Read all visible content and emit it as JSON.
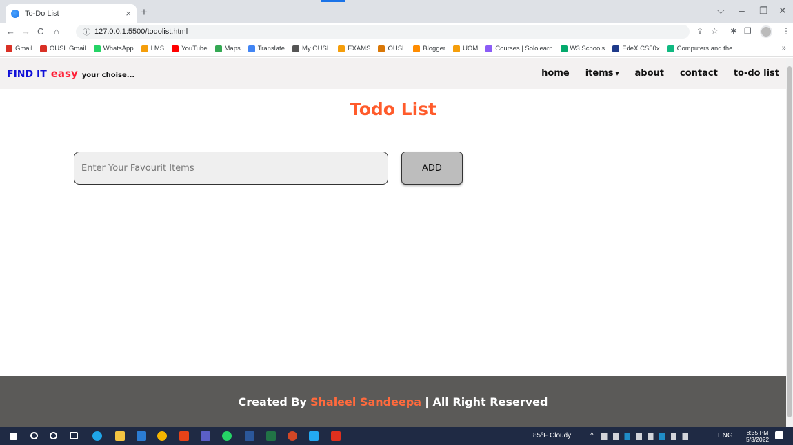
{
  "browser": {
    "tab_title": "To-Do List",
    "tab_close": "×",
    "new_tab": "+",
    "url": "127.0.0.1:5500/todolist.html",
    "nav": {
      "back": "←",
      "forward": "→",
      "reload": "C",
      "home": "⌂",
      "info": "ⓘ"
    },
    "window": {
      "dropdown": "⌵",
      "minimize": "–",
      "restore": "❐",
      "close": "✕"
    },
    "toolbar": {
      "share": "⇪",
      "star": "☆",
      "extensions": "✱",
      "sidebar": "❒",
      "menu": "⋮"
    },
    "bookmarks": [
      {
        "label": "Gmail",
        "color": "#d93025"
      },
      {
        "label": "OUSL Gmail",
        "color": "#d93025"
      },
      {
        "label": "WhatsApp",
        "color": "#25d366"
      },
      {
        "label": "LMS",
        "color": "#f59e0b"
      },
      {
        "label": "YouTube",
        "color": "#ff0000"
      },
      {
        "label": "Maps",
        "color": "#34a853"
      },
      {
        "label": "Translate",
        "color": "#4285f4"
      },
      {
        "label": "My OUSL",
        "color": "#555555"
      },
      {
        "label": "EXAMS",
        "color": "#f59e0b"
      },
      {
        "label": "OUSL",
        "color": "#d97706"
      },
      {
        "label": "Blogger",
        "color": "#ff8c00"
      },
      {
        "label": "UOM",
        "color": "#f59e0b"
      },
      {
        "label": "Courses | Sololearn",
        "color": "#8b5cf6"
      },
      {
        "label": "W3 Schools",
        "color": "#04aa6d"
      },
      {
        "label": "EdeX CS50x",
        "color": "#1e3a8a"
      },
      {
        "label": "Computers and the...",
        "color": "#10b981"
      }
    ],
    "bookmarks_more": "»"
  },
  "navbar": {
    "brand_find": "FIND IT",
    "brand_easy": "easy",
    "brand_tagline": "your choise...",
    "links": {
      "home": "home",
      "items": "items",
      "items_caret": "▾",
      "about": "about",
      "contact": "contact",
      "todo": "to-do list"
    }
  },
  "main": {
    "title": "Todo List",
    "input_placeholder": "Enter Your Favourit Items",
    "input_value": "",
    "add_label": "ADD"
  },
  "footer": {
    "prefix": "Created By",
    "author": "Shaleel Sandeepa",
    "suffix": "| All Right Reserved"
  },
  "taskbar": {
    "weather": "85°F  Cloudy",
    "tray_symbols": "^",
    "language": "ENG",
    "time": "8:35 PM",
    "date": "5/3/2022"
  },
  "colors": {
    "brand_blue": "#1010d8",
    "brand_red": "#ff1e35",
    "title_orange": "#ff5b2b",
    "footer_bg": "#5b5a58",
    "author_orange": "#ff6a3d"
  }
}
